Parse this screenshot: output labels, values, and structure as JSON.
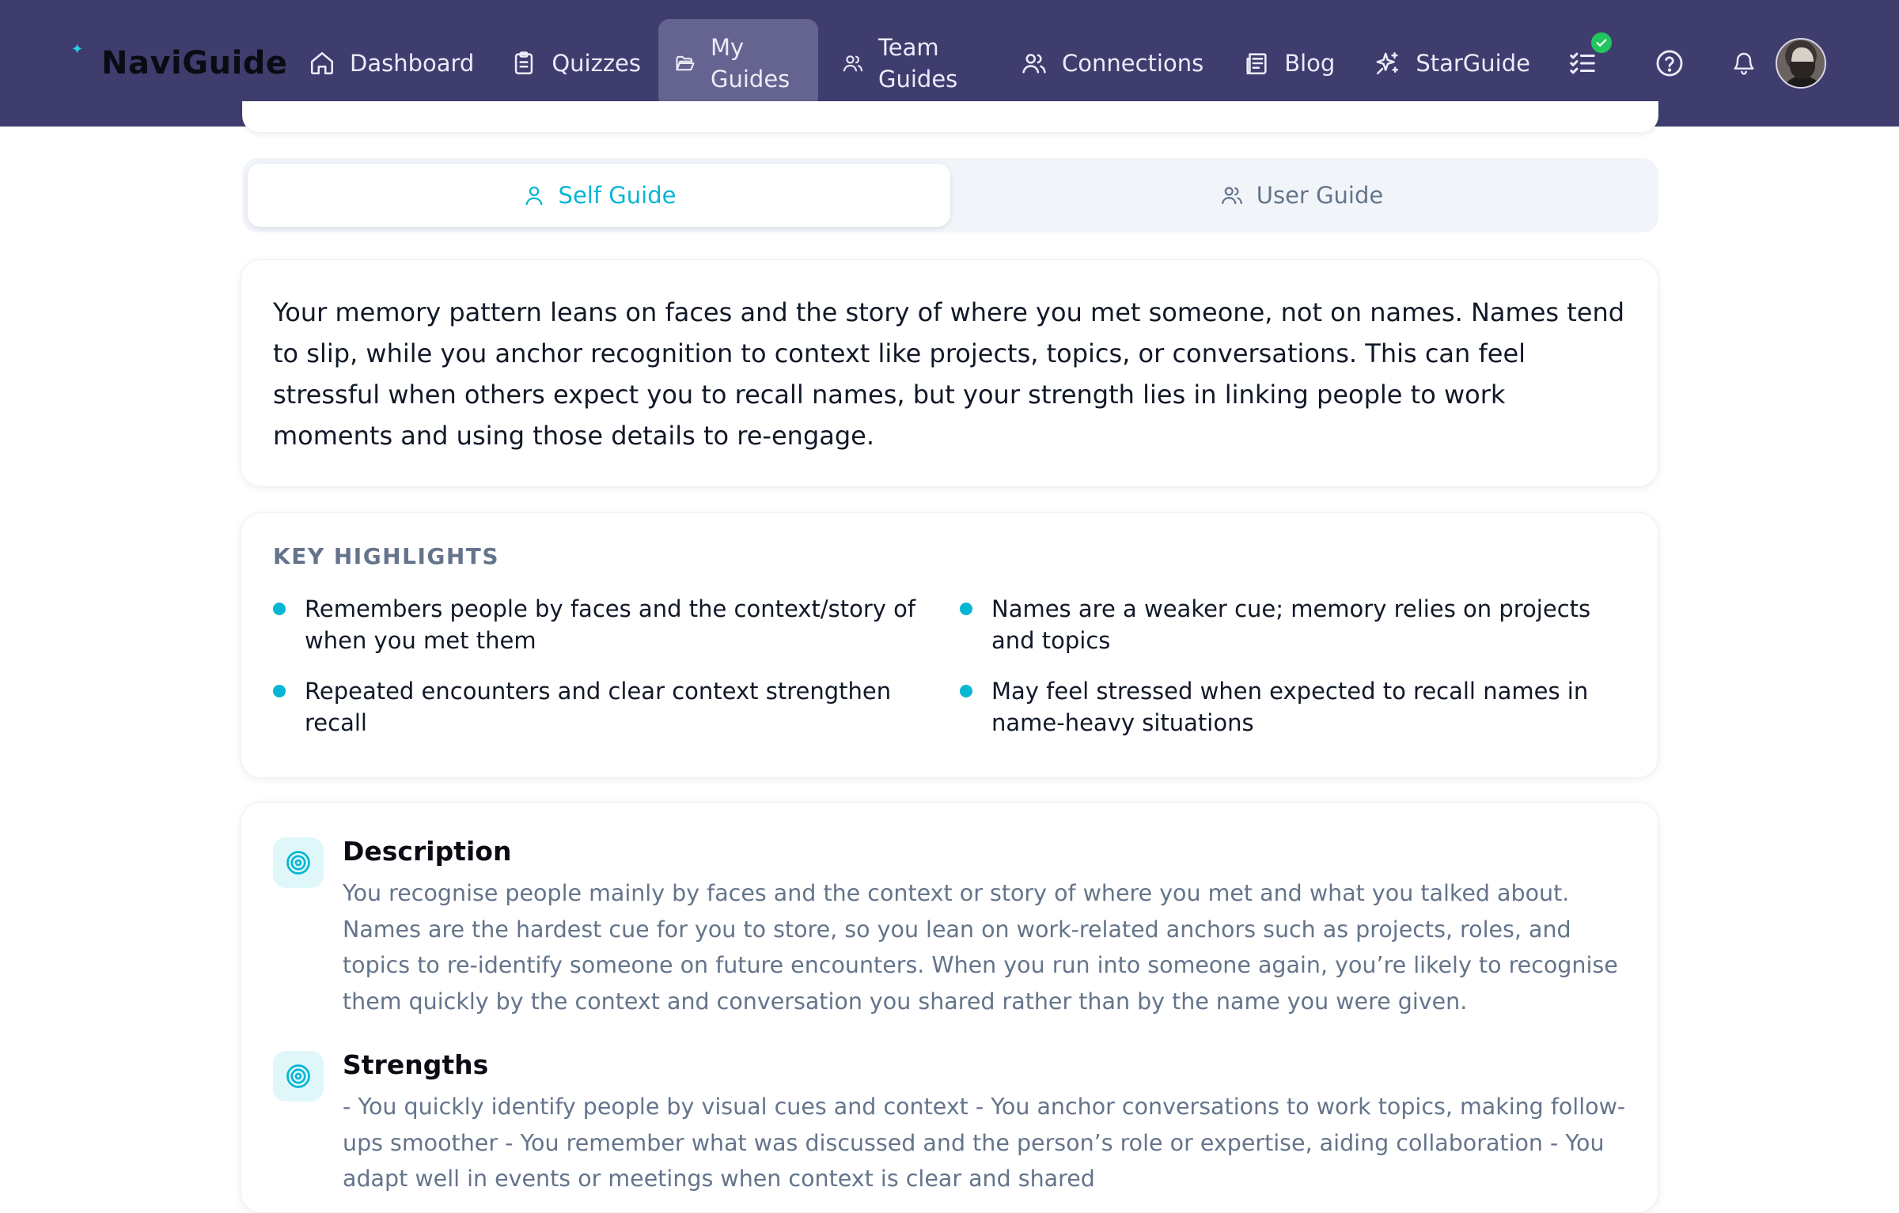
{
  "brand": {
    "name": "NaviGuide",
    "spark": "✦"
  },
  "nav": {
    "items": [
      {
        "label": "Dashboard",
        "icon": "home-icon"
      },
      {
        "label": "Quizzes",
        "icon": "clipboard-icon"
      },
      {
        "label": "My Guides",
        "icon": "folder-open-icon",
        "active": true
      },
      {
        "label": "Team Guides",
        "icon": "users-icon"
      },
      {
        "label": "Connections",
        "icon": "users-icon"
      },
      {
        "label": "Blog",
        "icon": "newspaper-icon"
      },
      {
        "label": "StarGuide",
        "icon": "sparkles-icon"
      }
    ]
  },
  "header_icons": [
    "checklist-icon",
    "help-circle-icon",
    "bell-icon"
  ],
  "tabs": {
    "self": "Self Guide",
    "user": "User Guide",
    "active": "self"
  },
  "summary": {
    "text": "Your memory pattern leans on faces and the story of where you met someone, not on names. Names tend to slip, while you anchor recognition to context like projects, topics, or conversations. This can feel stressful when others expect you to recall names, but your strength lies in linking people to work moments and using those details to re-engage."
  },
  "highlights": {
    "title": "KEY HIGHLIGHTS",
    "items": [
      "Remembers people by faces and the context/story of when you met them",
      "Names are a weaker cue; memory relies on projects and topics",
      "Repeated encounters and clear context strengthen recall",
      "May feel stressed when expected to recall names in name-heavy situations"
    ]
  },
  "sections": [
    {
      "title": "Description",
      "icon": "target-icon",
      "body": "You recognise people mainly by faces and the context or story of where you met and what you talked about. Names are the hardest cue for you to store, so you lean on work-related anchors such as projects, roles, and topics to re-identify someone on future encounters. When you run into someone again, you’re likely to recognise them quickly by the context and conversation you shared rather than by the name you were given."
    },
    {
      "title": "Strengths",
      "icon": "target-icon",
      "body": "- You quickly identify people by visual cues and context - You anchor conversations to work topics, making follow-ups smoother - You remember what was discussed and the person’s role or expertise, aiding collaboration - You adapt well in events or meetings when context is clear and shared"
    }
  ],
  "colors": {
    "topbar": "#3f3d6e",
    "accent": "#06b6d4",
    "muted": "#64748b",
    "badge": "#22c55e"
  }
}
